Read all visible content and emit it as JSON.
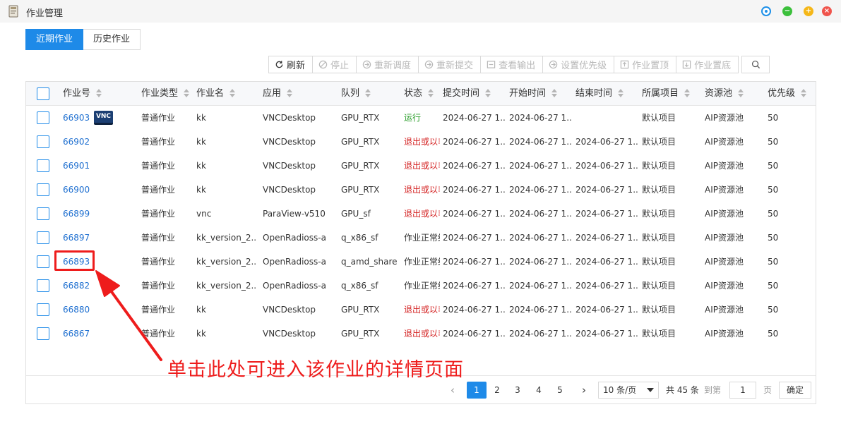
{
  "window": {
    "title": "作业管理"
  },
  "tabs": [
    {
      "label": "近期作业",
      "active": true
    },
    {
      "label": "历史作业",
      "active": false
    }
  ],
  "toolbar": {
    "refresh": "刷新",
    "stop": "停止",
    "reschedule": "重新调度",
    "resubmit": "重新提交",
    "view_output": "查看输出",
    "set_priority": "设置优先级",
    "pin_top": "作业置顶",
    "pin_bottom": "作业置底"
  },
  "table": {
    "headers": [
      "作业号",
      "作业类型",
      "作业名",
      "应用",
      "队列",
      "状态",
      "提交时间",
      "开始时间",
      "结束时间",
      "所属项目",
      "资源池",
      "优先级"
    ],
    "rows": [
      {
        "id": "66903",
        "type": "普通作业",
        "name": "kk",
        "app": "VNCDesktop",
        "queue": "GPU_RTX",
        "status": "运行",
        "submit": "2024-06-27 1...",
        "start": "2024-06-27 1...",
        "end": "",
        "project": "默认项目",
        "pool": "AIP资源池",
        "priority": "50",
        "vnc": "VNC"
      },
      {
        "id": "66902",
        "type": "普通作业",
        "name": "kk",
        "app": "VNCDesktop",
        "queue": "GPU_RTX",
        "status": "退出或以非",
        "submit": "2024-06-27 1...",
        "start": "2024-06-27 1...",
        "end": "2024-06-27 1...",
        "project": "默认项目",
        "pool": "AIP资源池",
        "priority": "50"
      },
      {
        "id": "66901",
        "type": "普通作业",
        "name": "kk",
        "app": "VNCDesktop",
        "queue": "GPU_RTX",
        "status": "退出或以非",
        "submit": "2024-06-27 1...",
        "start": "2024-06-27 1...",
        "end": "2024-06-27 1...",
        "project": "默认项目",
        "pool": "AIP资源池",
        "priority": "50"
      },
      {
        "id": "66900",
        "type": "普通作业",
        "name": "kk",
        "app": "VNCDesktop",
        "queue": "GPU_RTX",
        "status": "退出或以非",
        "submit": "2024-06-27 1...",
        "start": "2024-06-27 1...",
        "end": "2024-06-27 1...",
        "project": "默认项目",
        "pool": "AIP资源池",
        "priority": "50"
      },
      {
        "id": "66899",
        "type": "普通作业",
        "name": "vnc",
        "app": "ParaView-v510",
        "queue": "GPU_sf",
        "status": "退出或以非",
        "submit": "2024-06-27 1...",
        "start": "2024-06-27 1...",
        "end": "2024-06-27 1...",
        "project": "默认项目",
        "pool": "AIP资源池",
        "priority": "50"
      },
      {
        "id": "66897",
        "type": "普通作业",
        "name": "kk_version_2...",
        "app": "OpenRadioss-a",
        "queue": "q_x86_sf",
        "status": "作业正常结",
        "submit": "2024-06-27 1...",
        "start": "2024-06-27 1...",
        "end": "2024-06-27 1...",
        "project": "默认项目",
        "pool": "AIP资源池",
        "priority": "50"
      },
      {
        "id": "66893",
        "type": "普通作业",
        "name": "kk_version_2...",
        "app": "OpenRadioss-a",
        "queue": "q_amd_share",
        "status": "作业正常结",
        "submit": "2024-06-27 1...",
        "start": "2024-06-27 1...",
        "end": "2024-06-27 1...",
        "project": "默认项目",
        "pool": "AIP资源池",
        "priority": "50"
      },
      {
        "id": "66882",
        "type": "普通作业",
        "name": "kk_version_2...",
        "app": "OpenRadioss-a",
        "queue": "q_x86_sf",
        "status": "作业正常结",
        "submit": "2024-06-27 1...",
        "start": "2024-06-27 1...",
        "end": "2024-06-27 1...",
        "project": "默认项目",
        "pool": "AIP资源池",
        "priority": "50"
      },
      {
        "id": "66880",
        "type": "普通作业",
        "name": "kk",
        "app": "VNCDesktop",
        "queue": "GPU_RTX",
        "status": "退出或以非",
        "submit": "2024-06-27 1...",
        "start": "2024-06-27 1...",
        "end": "2024-06-27 1...",
        "project": "默认项目",
        "pool": "AIP资源池",
        "priority": "50"
      },
      {
        "id": "66867",
        "type": "普通作业",
        "name": "kk",
        "app": "VNCDesktop",
        "queue": "GPU_RTX",
        "status": "退出或以非",
        "submit": "2024-06-27 1...",
        "start": "2024-06-27 1...",
        "end": "2024-06-27 1...",
        "project": "默认项目",
        "pool": "AIP资源池",
        "priority": "50"
      }
    ]
  },
  "pagination": {
    "pages": [
      "1",
      "2",
      "3",
      "4",
      "5"
    ],
    "current": "1",
    "prev": "‹",
    "next": "›",
    "page_size": "10 条/页",
    "total": "共 45 条",
    "goto_label": "到第",
    "goto_value": "1",
    "page_unit": "页",
    "confirm": "确定"
  },
  "annotation": {
    "text": "单击此处可进入该作业的详情页面",
    "color": "#ee1c1c"
  },
  "colors": {
    "accent": "#1e8ae8",
    "link": "#1e6fd0",
    "running": "#2a9d2a",
    "exited": "#d42020"
  }
}
